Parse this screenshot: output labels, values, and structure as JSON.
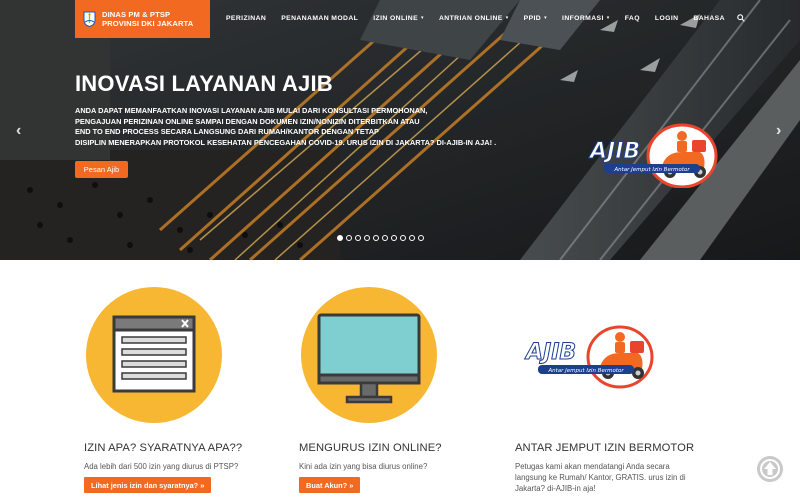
{
  "brand": {
    "line1": "DINAS PM & PTSP",
    "line2": "PROVINSI DKI JAKARTA",
    "accent": "#f26a21"
  },
  "nav": {
    "items": [
      {
        "label": "PERIZINAN",
        "dropdown": false
      },
      {
        "label": "PENANAMAN MODAL",
        "dropdown": false
      },
      {
        "label": "IZIN ONLINE",
        "dropdown": true
      },
      {
        "label": "ANTRIAN ONLINE",
        "dropdown": true
      },
      {
        "label": "PPID",
        "dropdown": true
      },
      {
        "label": "INFORMASI",
        "dropdown": true
      },
      {
        "label": "FAQ",
        "dropdown": false
      },
      {
        "label": "LOGIN",
        "dropdown": false
      },
      {
        "label": "BAHASA",
        "dropdown": false
      }
    ],
    "search_icon": "search-icon"
  },
  "hero": {
    "title": "INOVASI LAYANAN AJIB",
    "desc_lines": [
      "ANDA DAPAT MEMANFAATKAN INOVASI LAYANAN AJIB MULAI DARI KONSULTASI PERMOHONAN,",
      "PENGAJUAN PERIZINAN ONLINE SAMPAI DENGAN DOKUMEN IZIN/NONIZIN DITERBITKAN ATAU",
      "END TO END PROCESS SECARA LANGSUNG DARI RUMAH/KANTOR DENGAN TETAP",
      "DISIPLIN MENERAPKAN PROTOKOL KESEHATAN PENCEGAHAN COVID-19. URUS IZIN DI JAKARTA? DI-AJIB-IN AJA! ."
    ],
    "button": "Pesan Ajib",
    "prev": "‹",
    "next": "›",
    "slide_count": 10,
    "active_slide": 1,
    "logo_text": "AJIB",
    "logo_tagline": "Antar Jemput Izin Bermotor"
  },
  "features": [
    {
      "title": "IZIN APA? SYARATNYA APA??",
      "desc": "Ada lebih dari 500 izin yang diurus di PTSP?",
      "button": "Lihat jenis izin dan syaratnya? »",
      "icon": "browser-window-icon"
    },
    {
      "title": "MENGURUS IZIN ONLINE?",
      "desc": "Kini ada izin yang bisa diurus online?",
      "button": "Buat Akun? »",
      "icon": "monitor-icon"
    },
    {
      "title": "ANTAR JEMPUT IZIN BERMOTOR",
      "desc_lines": [
        "Petugas kami akan mendatangi Anda secara",
        "langsung ke Rumah/ Kantor, GRATIS. urus izin di",
        "Jakarta? di-AJIB-in aja!"
      ],
      "icon": "ajib-logo",
      "logo_text": "AJIB",
      "logo_tagline": "Antar Jemput Izin Bermotor"
    }
  ],
  "scroll_top_icon": "arrow-up-icon"
}
